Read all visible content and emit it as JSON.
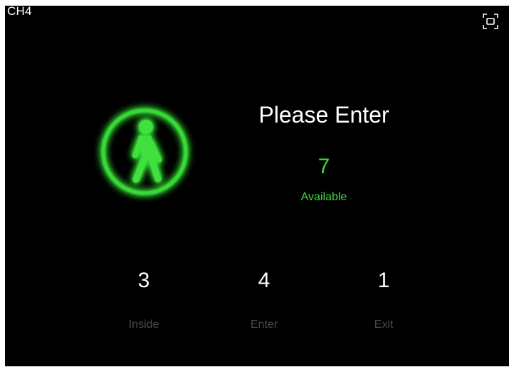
{
  "channel": {
    "label": "CH4"
  },
  "controls": {
    "fullscreen_icon": "fullscreen-icon"
  },
  "status": {
    "icon": "walking-person-icon",
    "title": "Please Enter",
    "available_count": "7",
    "available_label": "Available"
  },
  "counters": {
    "inside": {
      "value": "3",
      "label": "Inside"
    },
    "enter": {
      "value": "4",
      "label": "Enter"
    },
    "exit": {
      "value": "1",
      "label": "Exit"
    }
  },
  "colors": {
    "background": "#000000",
    "accent_green": "#3ddc3d",
    "primary_text": "#ffffff",
    "muted_text": "#4a4a4a"
  }
}
